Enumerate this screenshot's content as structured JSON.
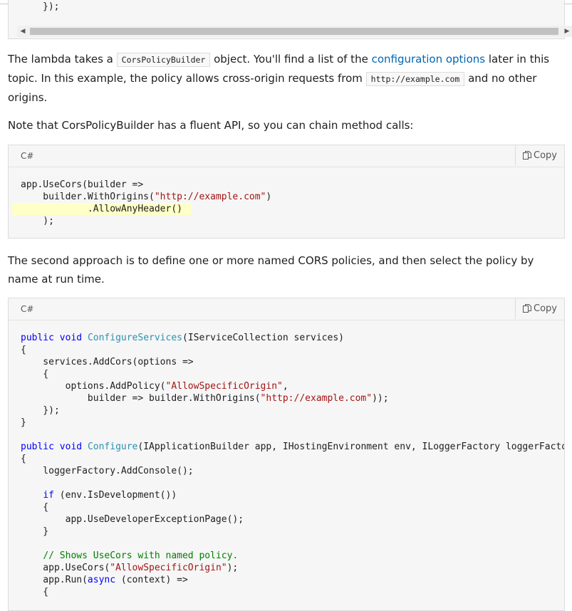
{
  "previous_code": {
    "tail": "});"
  },
  "paragraph1": {
    "part1": "The lambda takes a ",
    "code1": "CorsPolicyBuilder",
    "part2": " object. You'll find a list of the ",
    "link": "configuration options",
    "part3": " later in this topic. In this example, the policy allows cross-origin requests from ",
    "code2": "http://example.com",
    "part4": " and no other origins."
  },
  "paragraph2": "Note that CorsPolicyBuilder has a fluent API, so you can chain method calls:",
  "paragraph3": "The second approach is to define one or more named CORS policies, and then select the policy by name at run time.",
  "code_blocks": [
    {
      "language": "C#",
      "copy_label": "Copy",
      "highlighted_line": 2,
      "lines": [
        [
          [
            "",
            "app.UseCors(builder =>"
          ]
        ],
        [
          [
            "",
            "    builder.WithOrigins("
          ],
          [
            "st",
            "\"http://example.com\""
          ],
          [
            "",
            ")"
          ]
        ],
        [
          [
            "",
            "            .AllowAnyHeader()"
          ]
        ],
        [
          [
            "",
            "    );"
          ]
        ]
      ]
    },
    {
      "language": "C#",
      "copy_label": "Copy",
      "lines": [
        [
          [
            "kw",
            "public"
          ],
          [
            "",
            " "
          ],
          [
            "kw",
            "void"
          ],
          [
            "",
            " "
          ],
          [
            "ty",
            "ConfigureServices"
          ],
          [
            "",
            "(IServiceCollection services)"
          ]
        ],
        [
          [
            "",
            "{"
          ]
        ],
        [
          [
            "",
            "    services.AddCors(options =>"
          ]
        ],
        [
          [
            "",
            "    {"
          ]
        ],
        [
          [
            "",
            "        options.AddPolicy("
          ],
          [
            "st",
            "\"AllowSpecificOrigin\""
          ],
          [
            "",
            ","
          ]
        ],
        [
          [
            "",
            "            builder => builder.WithOrigins("
          ],
          [
            "st",
            "\"http://example.com\""
          ],
          [
            "",
            "));"
          ]
        ],
        [
          [
            "",
            "    });"
          ]
        ],
        [
          [
            "",
            "}"
          ]
        ],
        [
          [
            "",
            ""
          ]
        ],
        [
          [
            "kw",
            "public"
          ],
          [
            "",
            " "
          ],
          [
            "kw",
            "void"
          ],
          [
            "",
            " "
          ],
          [
            "ty",
            "Configure"
          ],
          [
            "",
            "(IApplicationBuilder app, IHostingEnvironment env, ILoggerFactory loggerFactory)"
          ]
        ],
        [
          [
            "",
            "{"
          ]
        ],
        [
          [
            "",
            "    loggerFactory.AddConsole();"
          ]
        ],
        [
          [
            "",
            ""
          ]
        ],
        [
          [
            "",
            "    "
          ],
          [
            "kw",
            "if"
          ],
          [
            "",
            " (env.IsDevelopment())"
          ]
        ],
        [
          [
            "",
            "    {"
          ]
        ],
        [
          [
            "",
            "        app.UseDeveloperExceptionPage();"
          ]
        ],
        [
          [
            "",
            "    }"
          ]
        ],
        [
          [
            "",
            ""
          ]
        ],
        [
          [
            "",
            "    "
          ],
          [
            "cm",
            "// Shows UseCors with named policy."
          ]
        ],
        [
          [
            "",
            "    app.UseCors("
          ],
          [
            "st",
            "\"AllowSpecificOrigin\""
          ],
          [
            "",
            ");"
          ]
        ],
        [
          [
            "",
            "    app.Run("
          ],
          [
            "kw",
            "async"
          ],
          [
            "",
            " (context) =>"
          ]
        ],
        [
          [
            "",
            "    {"
          ]
        ]
      ]
    }
  ]
}
